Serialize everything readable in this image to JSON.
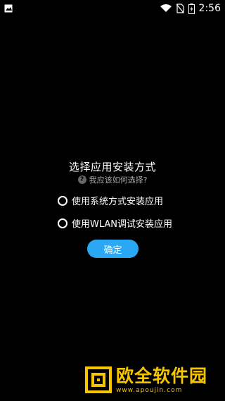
{
  "status_bar": {
    "time": "2:56",
    "icons": [
      "image-icon",
      "wifi-icon",
      "no-sim-icon",
      "battery-charging-icon"
    ]
  },
  "dialog": {
    "title": "选择应用安装方式",
    "help_text": "我应该如何选择?",
    "options": [
      {
        "label": "使用系统方式安装应用",
        "selected": false
      },
      {
        "label": "使用WLAN调试安装应用",
        "selected": false
      }
    ],
    "confirm_label": "确定"
  },
  "watermark": {
    "brand": "欧全软件园",
    "url": "www.apoujin.com",
    "color": "#f7c400"
  },
  "colors": {
    "background": "#000000",
    "accent": "#2aa8f3"
  }
}
